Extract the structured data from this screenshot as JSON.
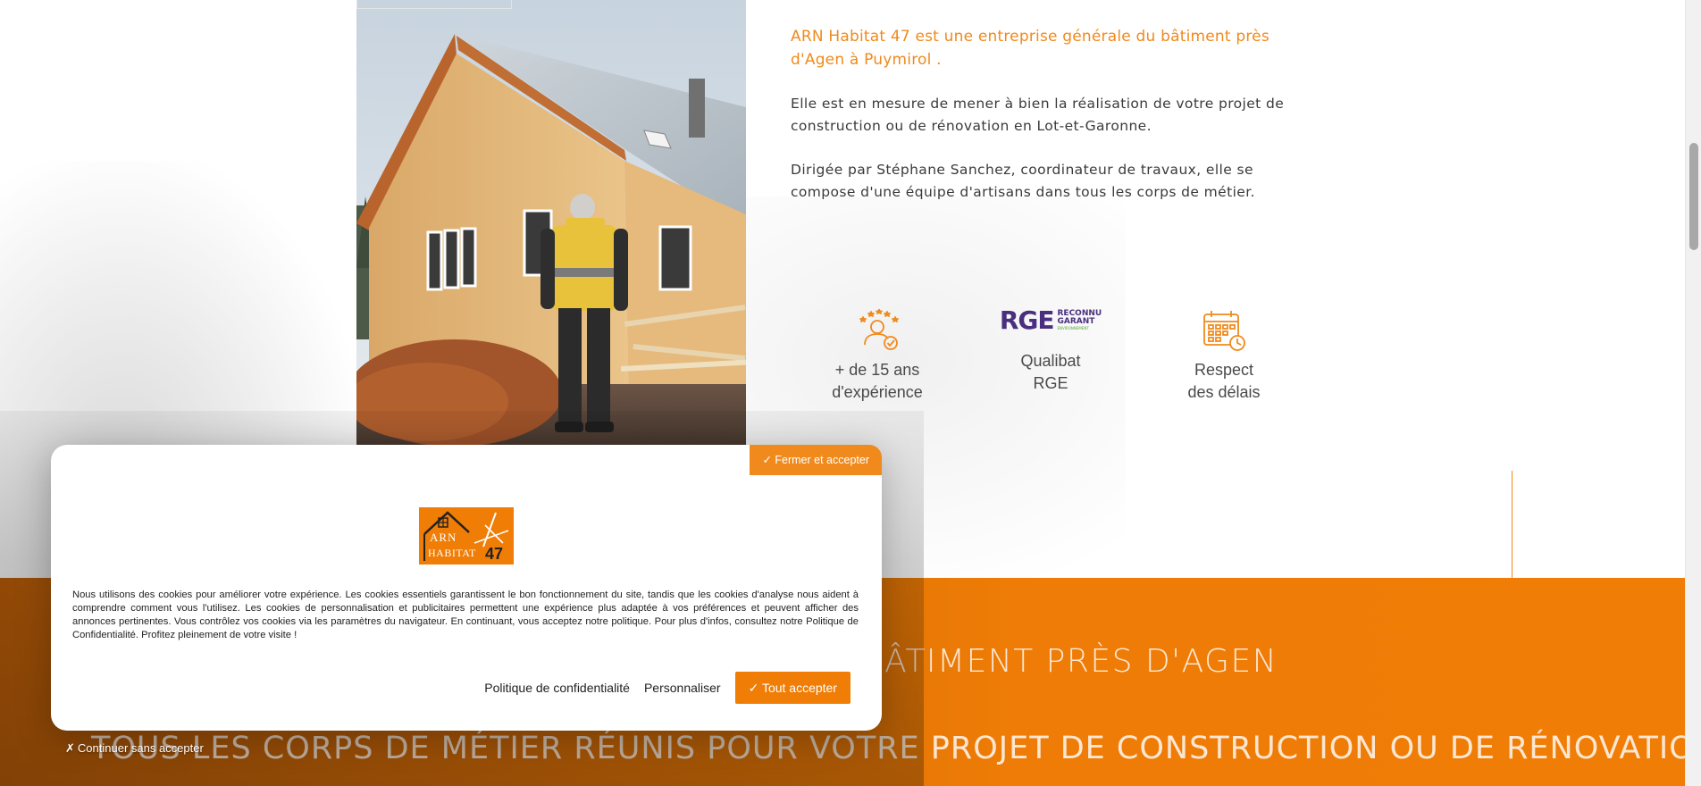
{
  "intro": {
    "lead": "ARN Habitat 47 est une entreprise générale du bâtiment près d'Agen à Puymirol .",
    "paragraph1": "Elle est en mesure de mener à bien la réalisation de votre projet de construction ou de rénovation en Lot-et-Garonne.",
    "paragraph2": "Dirigée par Stéphane Sanchez, coordinateur de travaux, elle se compose d'une équipe d'artisans dans tous les corps de métier."
  },
  "features": [
    {
      "line1": "+ de 15 ans",
      "line2": "d'expérience",
      "icon": "expert-stars-icon"
    },
    {
      "line1": "Qualibat",
      "line2": "RGE",
      "icon": "rge-logo",
      "logo_text": "RGE",
      "logo_sub1": "RECONNU",
      "logo_sub2": "GARANT",
      "logo_sub3": "ENVIRONNEMENT"
    },
    {
      "line1": "Respect",
      "line2": "des délais",
      "icon": "calendar-clock-icon"
    }
  ],
  "band": {
    "title1": "BÂTIMENT PRÈS D'AGEN",
    "title2": "TOUS LES CORPS DE MÉTIER RÉUNIS POUR VOTRE PROJET DE CONSTRUCTION OU DE RÉNOVATION"
  },
  "cookie": {
    "close_label": "✓ Fermer et accepter",
    "logo_line1": "ARN",
    "logo_line2": "HABITAT",
    "logo_num": "47",
    "text": "Nous utilisons des cookies pour améliorer votre expérience. Les cookies essentiels garantissent le bon fonctionnement du site, tandis que les cookies d'analyse nous aident à comprendre comment vous l'utilisez. Les cookies de personnalisation et publicitaires permettent une expérience plus adaptée à vos préférences et peuvent afficher des annonces pertinentes. Vous contrôlez vos cookies via les paramètres du navigateur. En continuant, vous acceptez notre politique. Pour plus d'infos, consultez notre Politique de Confidentialité. Profitez pleinement de votre visite !",
    "privacy_label": "Politique de confidentialité",
    "customize_label": "Personnaliser",
    "accept_all_label": "✓ Tout accepter",
    "continue_label": "Continuer sans accepter",
    "continue_icon": "✗"
  },
  "colors": {
    "accent": "#f08a1c",
    "band": "#f07d05",
    "rge_purple": "#4a2f7f",
    "rge_green": "#5aa832"
  }
}
